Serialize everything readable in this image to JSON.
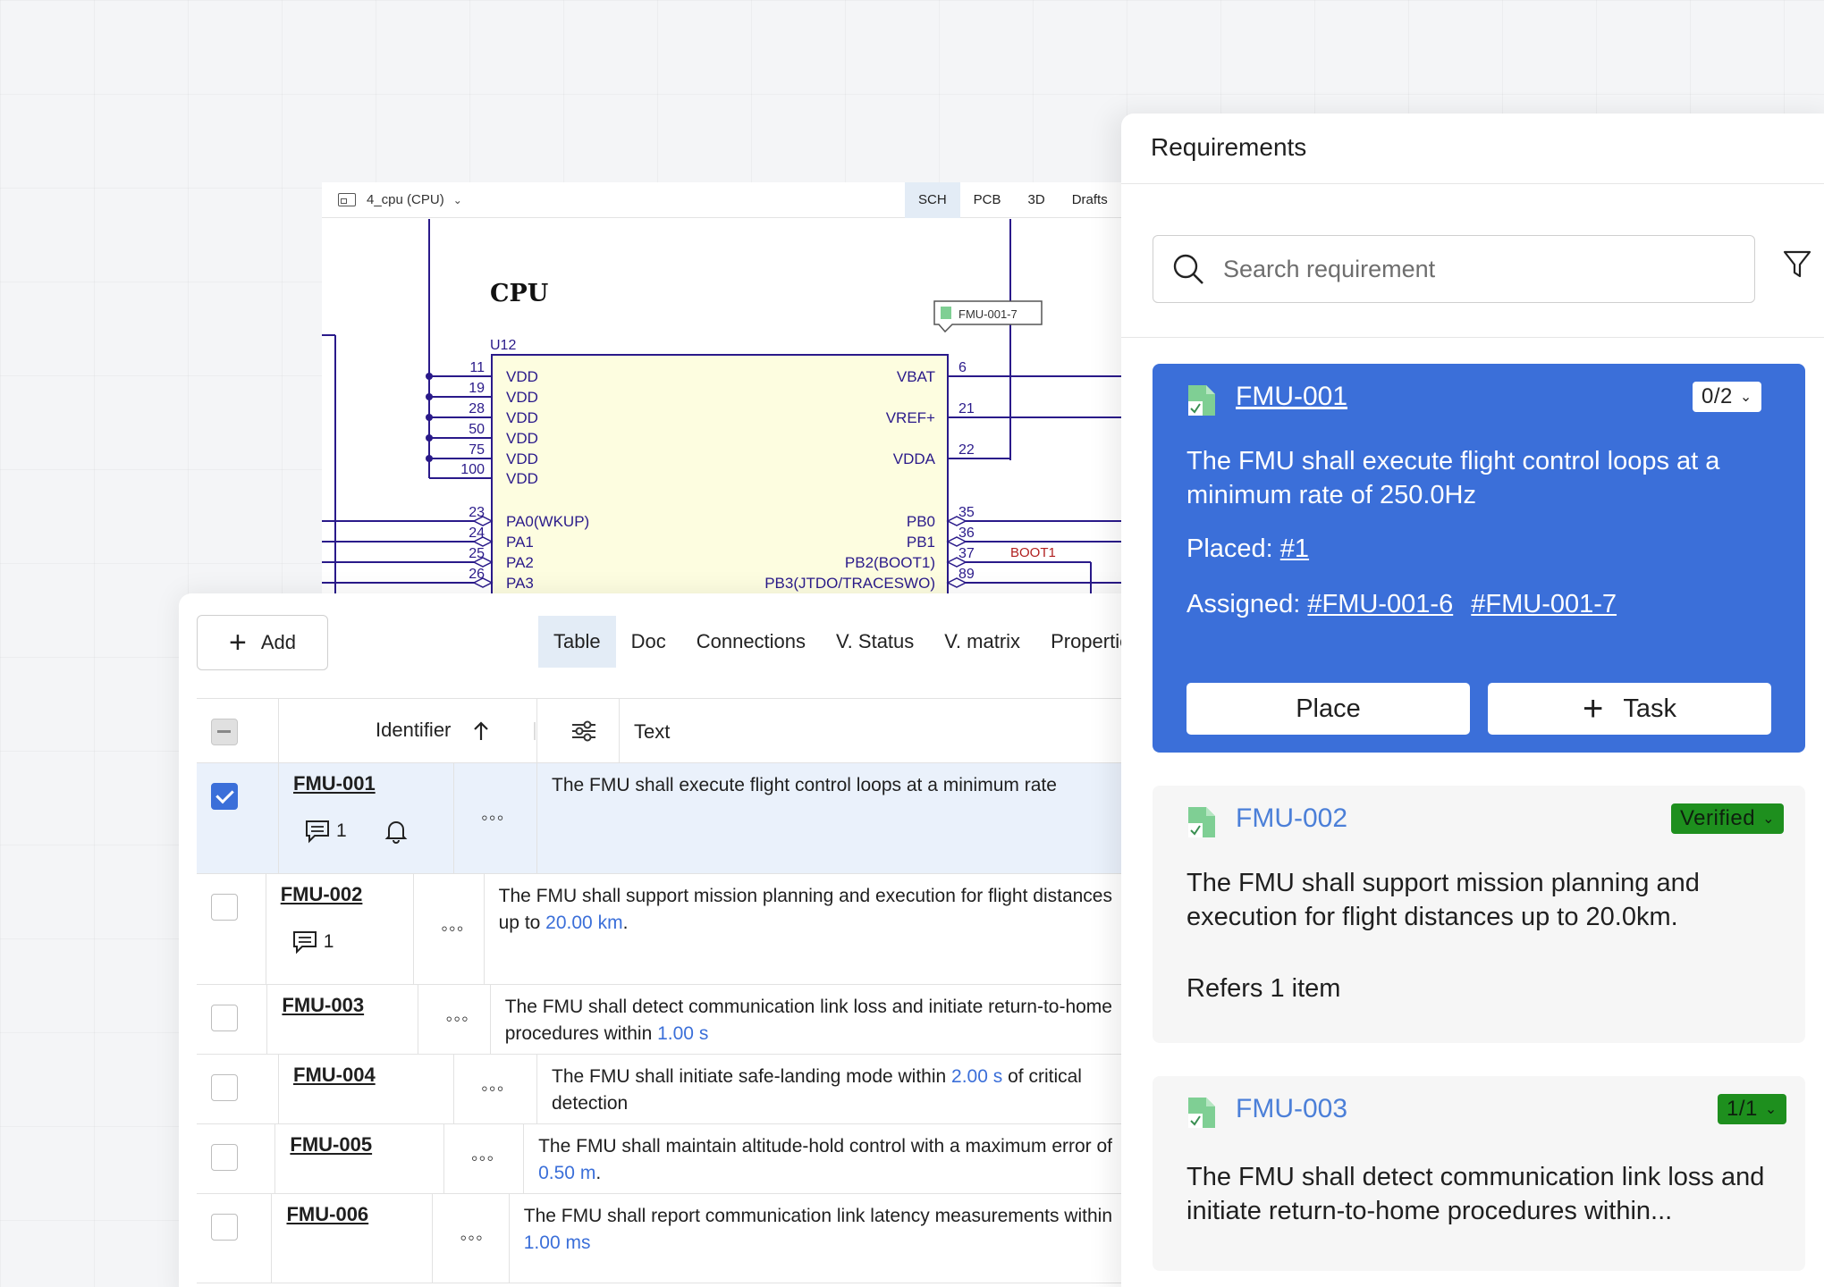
{
  "schematic": {
    "sheet_name": "4_cpu (CPU)",
    "view_tabs": [
      "SCH",
      "PCB",
      "3D",
      "Drafts"
    ],
    "active_view": "SCH",
    "title": "CPU",
    "designator": "U12",
    "tag": "FMU-001-7",
    "net_label": "BOOT1",
    "left_pins": [
      {
        "num": "11",
        "name": "VDD"
      },
      {
        "num": "19",
        "name": "VDD"
      },
      {
        "num": "28",
        "name": "VDD"
      },
      {
        "num": "50",
        "name": "VDD"
      },
      {
        "num": "75",
        "name": "VDD"
      },
      {
        "num": "100",
        "name": "VDD"
      },
      {
        "num": "23",
        "name": "PA0(WKUP)"
      },
      {
        "num": "24",
        "name": "PA1"
      },
      {
        "num": "25",
        "name": "PA2"
      },
      {
        "num": "26",
        "name": "PA3"
      }
    ],
    "right_pins": [
      {
        "num": "6",
        "name": "VBAT"
      },
      {
        "num": "21",
        "name": "VREF+"
      },
      {
        "num": "22",
        "name": "VDDA"
      },
      {
        "num": "35",
        "name": "PB0"
      },
      {
        "num": "36",
        "name": "PB1"
      },
      {
        "num": "37",
        "name": "PB2(BOOT1)"
      },
      {
        "num": "89",
        "name": "PB3(JTDO/TRACESWO)"
      }
    ]
  },
  "table_panel": {
    "add_label": "Add",
    "tabs": [
      "Table",
      "Doc",
      "Connections",
      "V. Status",
      "V. matrix",
      "Properties"
    ],
    "active_tab": "Table",
    "columns": {
      "identifier": "Identifier",
      "text": "Text"
    },
    "rows": [
      {
        "id": "FMU-001",
        "checked": true,
        "comments": "1",
        "bell": true,
        "text_a": "The FMU shall execute flight control loops at a minimum rate",
        "num_a": "",
        "unit_a": "",
        "text_b": "",
        "num_b": "",
        "unit_b": "",
        "text_c": ""
      },
      {
        "id": "FMU-002",
        "checked": false,
        "comments": "1",
        "bell": false,
        "text_a": "The FMU shall support mission planning and execution for flight distances",
        "num_a": "",
        "unit_a": "",
        "text_b": "up to ",
        "num_b": "20.00",
        "unit_b": "km",
        "text_c": "."
      },
      {
        "id": "FMU-003",
        "checked": false,
        "comments": "",
        "bell": false,
        "text_a": "The FMU shall detect communication link loss and initiate return-to-home",
        "num_a": "",
        "unit_a": "",
        "text_b": "procedures within ",
        "num_b": "1.00",
        "unit_b": "s",
        "text_c": ""
      },
      {
        "id": "FMU-004",
        "checked": false,
        "comments": "",
        "bell": false,
        "text_a": "The FMU shall initiate safe-landing mode within ",
        "num_a": "2.00",
        "unit_a": "s",
        "text_b": " of critical",
        "num_b": "",
        "unit_b": "",
        "text_c": "detection"
      },
      {
        "id": "FMU-005",
        "checked": false,
        "comments": "",
        "bell": false,
        "text_a": "The FMU shall maintain altitude-hold control with a maximum error of",
        "num_a": "",
        "unit_a": "",
        "text_b": "",
        "num_b": "0.50",
        "unit_b": "m",
        "text_c": "."
      },
      {
        "id": "FMU-006",
        "checked": false,
        "comments": "",
        "bell": false,
        "text_a": "The FMU shall report communication link latency measurements within",
        "num_a": "",
        "unit_a": "",
        "text_b": "",
        "num_b": "1.00",
        "unit_b": "ms",
        "text_c": ""
      }
    ]
  },
  "requirements": {
    "title": "Requirements",
    "search_placeholder": "Search requirement",
    "cards": [
      {
        "id": "FMU-001",
        "badge": "0/2",
        "text": "The FMU shall execute flight control loops at a minimum rate of 250.0Hz",
        "placed_label": "Placed:",
        "placed_link": "#1",
        "assigned_label": "Assigned:",
        "assigned_links": [
          "#FMU-001-6",
          "#FMU-001-7"
        ],
        "place_button": "Place",
        "task_button": "Task"
      },
      {
        "id": "FMU-002",
        "badge": "Verified",
        "text": "The FMU shall support mission planning and execution for flight distances up to 20.0km.",
        "refers": "Refers 1 item"
      },
      {
        "id": "FMU-003",
        "badge": "1/1",
        "text": "The FMU shall detect communication link loss and initiate return-to-home procedures within..."
      }
    ]
  },
  "colors": {
    "accent": "#3b6fd9",
    "verified": "#1e8f1e",
    "schematic_wire": "#2a1a8a",
    "component_fill": "#fdfde0"
  }
}
